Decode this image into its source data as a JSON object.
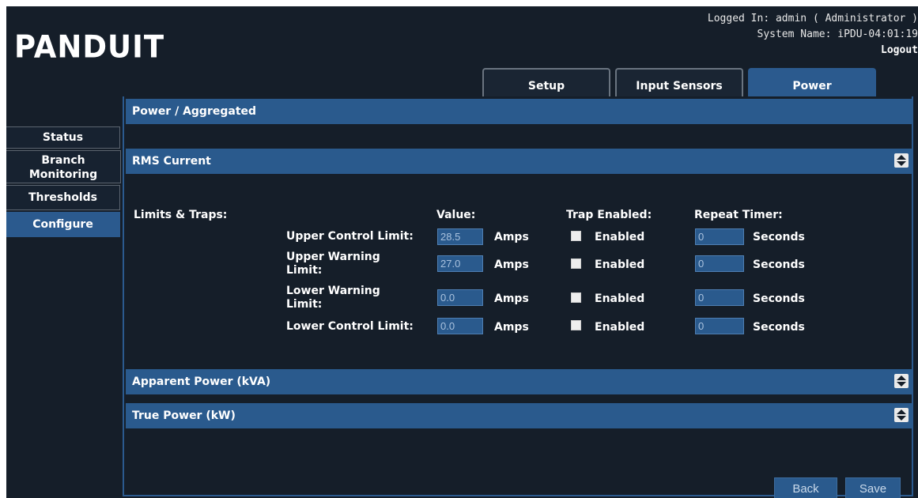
{
  "brand": {
    "logo_text": "PANDUIT"
  },
  "user": {
    "logged_in": "Logged In: admin ( Administrator )",
    "system_name": "System Name: iPDU-04:01:19",
    "logout": "Logout"
  },
  "tabs": [
    {
      "label": "Setup",
      "active": false
    },
    {
      "label": "Input Sensors",
      "active": false
    },
    {
      "label": "Power",
      "active": true
    }
  ],
  "sidebar": {
    "items": [
      {
        "label": "Status",
        "active": false
      },
      {
        "label": "Branch Monitoring",
        "active": false
      },
      {
        "label": "Thresholds",
        "active": false
      },
      {
        "label": "Configure",
        "active": true
      }
    ]
  },
  "page": {
    "title": "Power / Aggregated"
  },
  "sections": {
    "rms": {
      "title": "RMS Current"
    },
    "apparent": {
      "title": "Apparent Power (kVA)"
    },
    "true_power": {
      "title": "True Power (kW)"
    }
  },
  "limits": {
    "heading": "Limits & Traps:",
    "col_value": "Value:",
    "col_trap": "Trap Enabled:",
    "col_repeat": "Repeat Timer:",
    "unit": "Amps",
    "enabled_label": "Enabled",
    "timer_unit": "Seconds",
    "rows": [
      {
        "label": "Upper Control Limit:",
        "value": "28.5",
        "timer": "0",
        "enabled": false
      },
      {
        "label": "Upper Warning Limit:",
        "value": "27.0",
        "timer": "0",
        "enabled": false
      },
      {
        "label": "Lower Warning Limit:",
        "value": "0.0",
        "timer": "0",
        "enabled": false
      },
      {
        "label": "Lower Control Limit:",
        "value": "0.0",
        "timer": "0",
        "enabled": false
      }
    ]
  },
  "buttons": {
    "back": "Back",
    "save": "Save"
  },
  "colors": {
    "background": "#151e29",
    "accent": "#2a5a8d"
  },
  "icons": {
    "section_toggle": "expand-collapse-icon"
  }
}
